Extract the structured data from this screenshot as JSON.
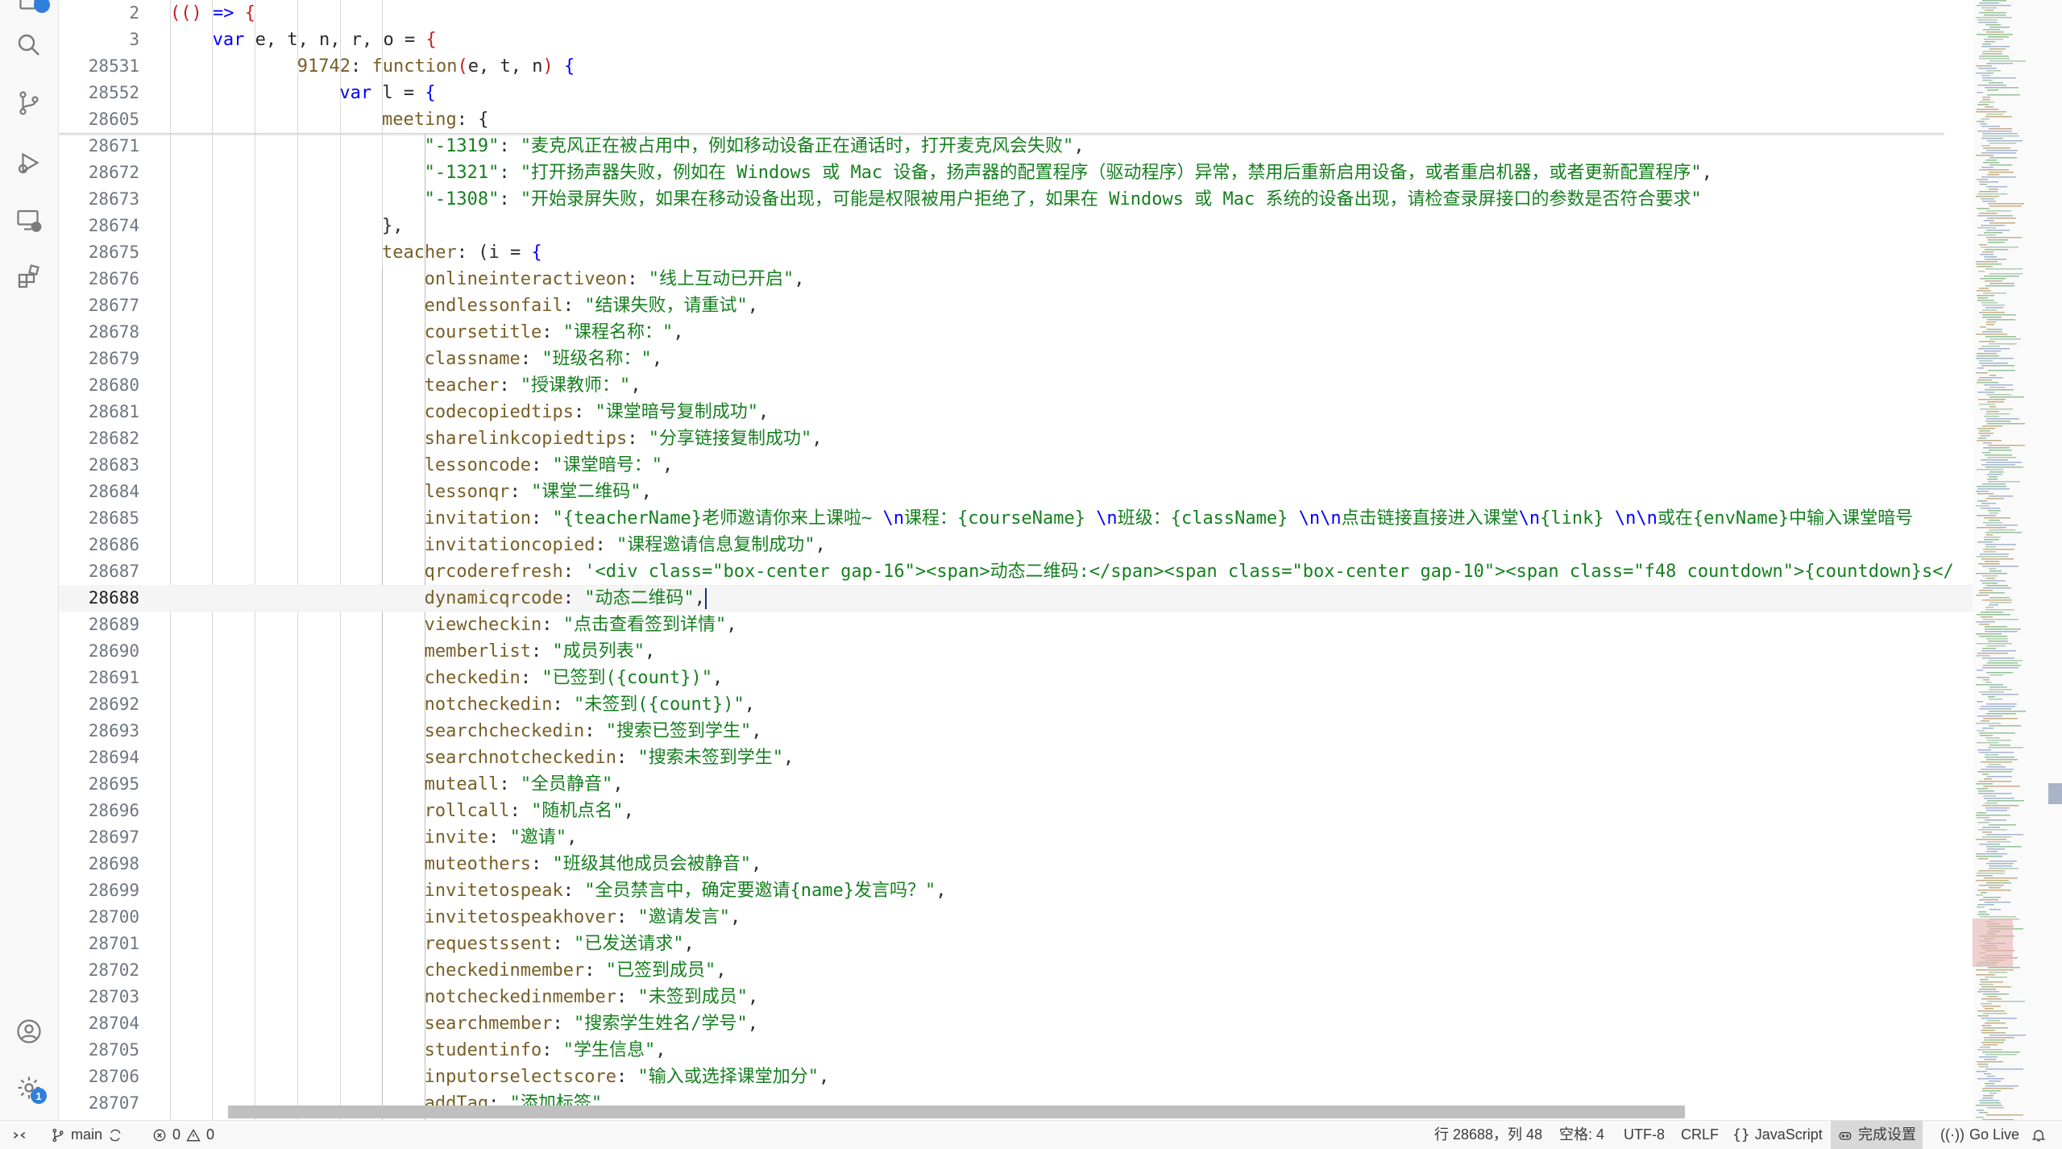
{
  "activity_bar": {
    "icons": [
      "explorer-icon",
      "search-icon",
      "source-control-icon",
      "run-debug-icon",
      "remote-explorer-icon",
      "extensions-icon",
      "account-icon",
      "settings-gear-icon"
    ],
    "settings_badge": "1"
  },
  "editor": {
    "lines": [
      {
        "n": "2",
        "indent": 0,
        "tokens": [
          [
            "p",
            "(("
          ],
          [
            "p",
            ")"
          ],
          [
            "t",
            " "
          ],
          [
            "k",
            "=>"
          ],
          [
            "t",
            " "
          ],
          [
            "p",
            "{"
          ]
        ]
      },
      {
        "n": "3",
        "indent": 1,
        "tokens": [
          [
            "k",
            "var"
          ],
          [
            "t",
            " e, t, n, r, o "
          ],
          [
            "t",
            "= "
          ],
          [
            "p",
            "{"
          ]
        ]
      },
      {
        "n": "28531",
        "indent": 3,
        "tokens": [
          [
            "n",
            "91742"
          ],
          [
            "t",
            ": "
          ],
          [
            "n",
            "function"
          ],
          [
            "p",
            "("
          ],
          [
            "t",
            "e, t, n"
          ],
          [
            "p",
            ")"
          ],
          [
            "t",
            " "
          ],
          [
            "k",
            "{"
          ]
        ]
      },
      {
        "n": "28552",
        "indent": 4,
        "tokens": [
          [
            "k",
            "var"
          ],
          [
            "t",
            " l = "
          ],
          [
            "k",
            "{"
          ]
        ]
      },
      {
        "n": "28605",
        "indent": 5,
        "tokens": [
          [
            "n",
            "meeting"
          ],
          [
            "t",
            ": {"
          ]
        ]
      },
      {
        "n": "28671",
        "indent": 6,
        "tokens": [
          [
            "s",
            "\"-1319\""
          ],
          [
            "t",
            ": "
          ],
          [
            "s",
            "\"麦克风正在被占用中，例如移动设备正在通话时，打开麦克风会失败\""
          ],
          [
            "t",
            ","
          ]
        ]
      },
      {
        "n": "28672",
        "indent": 6,
        "tokens": [
          [
            "s",
            "\"-1321\""
          ],
          [
            "t",
            ": "
          ],
          [
            "s",
            "\"打开扬声器失败，例如在 Windows 或 Mac 设备，扬声器的配置程序（驱动程序）异常，禁用后重新启用设备，或者重启机器，或者更新配置程序\""
          ],
          [
            "t",
            ","
          ]
        ]
      },
      {
        "n": "28673",
        "indent": 6,
        "tokens": [
          [
            "s",
            "\"-1308\""
          ],
          [
            "t",
            ": "
          ],
          [
            "s",
            "\"开始录屏失败，如果在移动设备出现，可能是权限被用户拒绝了，如果在 Windows 或 Mac 系统的设备出现，请检查录屏接口的参数是否符合要求\""
          ]
        ]
      },
      {
        "n": "28674",
        "indent": 5,
        "tokens": [
          [
            "t",
            "},"
          ]
        ]
      },
      {
        "n": "28675",
        "indent": 5,
        "tokens": [
          [
            "n",
            "teacher"
          ],
          [
            "t",
            ": (i = "
          ],
          [
            "k",
            "{"
          ]
        ]
      },
      {
        "n": "28676",
        "indent": 6,
        "tokens": [
          [
            "n",
            "onlineinteractiveon"
          ],
          [
            "t",
            ": "
          ],
          [
            "s",
            "\"线上互动已开启\""
          ],
          [
            "t",
            ","
          ]
        ]
      },
      {
        "n": "28677",
        "indent": 6,
        "tokens": [
          [
            "n",
            "endlessonfail"
          ],
          [
            "t",
            ": "
          ],
          [
            "s",
            "\"结课失败，请重试\""
          ],
          [
            "t",
            ","
          ]
        ]
      },
      {
        "n": "28678",
        "indent": 6,
        "tokens": [
          [
            "n",
            "coursetitle"
          ],
          [
            "t",
            ": "
          ],
          [
            "s",
            "\"课程名称：\""
          ],
          [
            "t",
            ","
          ]
        ]
      },
      {
        "n": "28679",
        "indent": 6,
        "tokens": [
          [
            "n",
            "classname"
          ],
          [
            "t",
            ": "
          ],
          [
            "s",
            "\"班级名称：\""
          ],
          [
            "t",
            ","
          ]
        ]
      },
      {
        "n": "28680",
        "indent": 6,
        "tokens": [
          [
            "n",
            "teacher"
          ],
          [
            "t",
            ": "
          ],
          [
            "s",
            "\"授课教师：\""
          ],
          [
            "t",
            ","
          ]
        ]
      },
      {
        "n": "28681",
        "indent": 6,
        "tokens": [
          [
            "n",
            "codecopiedtips"
          ],
          [
            "t",
            ": "
          ],
          [
            "s",
            "\"课堂暗号复制成功\""
          ],
          [
            "t",
            ","
          ]
        ]
      },
      {
        "n": "28682",
        "indent": 6,
        "tokens": [
          [
            "n",
            "sharelinkcopiedtips"
          ],
          [
            "t",
            ": "
          ],
          [
            "s",
            "\"分享链接复制成功\""
          ],
          [
            "t",
            ","
          ]
        ]
      },
      {
        "n": "28683",
        "indent": 6,
        "tokens": [
          [
            "n",
            "lessoncode"
          ],
          [
            "t",
            ": "
          ],
          [
            "s",
            "\"课堂暗号：\""
          ],
          [
            "t",
            ","
          ]
        ]
      },
      {
        "n": "28684",
        "indent": 6,
        "tokens": [
          [
            "n",
            "lessonqr"
          ],
          [
            "t",
            ": "
          ],
          [
            "s",
            "\"课堂二维码\""
          ],
          [
            "t",
            ","
          ]
        ]
      },
      {
        "n": "28685",
        "indent": 6,
        "tokens": [
          [
            "n",
            "invitation"
          ],
          [
            "t",
            ": "
          ],
          [
            "s",
            "\"{teacherName}老师邀请你来上课啦~ "
          ],
          [
            "k",
            "\\n"
          ],
          [
            "s",
            "课程："
          ],
          [
            "s",
            "{courseName} "
          ],
          [
            "k",
            "\\n"
          ],
          [
            "s",
            "班级："
          ],
          [
            "s",
            "{className} "
          ],
          [
            "k",
            "\\n\\n"
          ],
          [
            "s",
            "点击链接直接进入课堂"
          ],
          [
            "k",
            "\\n"
          ],
          [
            "s",
            "{link} "
          ],
          [
            "k",
            "\\n\\n"
          ],
          [
            "s",
            "或在{envName}中输入课堂暗号"
          ]
        ]
      },
      {
        "n": "28686",
        "indent": 6,
        "tokens": [
          [
            "n",
            "invitationcopied"
          ],
          [
            "t",
            ": "
          ],
          [
            "s",
            "\"课程邀请信息复制成功\""
          ],
          [
            "t",
            ","
          ]
        ]
      },
      {
        "n": "28687",
        "indent": 6,
        "tokens": [
          [
            "n",
            "qrcoderefresh"
          ],
          [
            "t",
            ": "
          ],
          [
            "s",
            "'<div class=\"box-center gap-16\"><span>动态二维码:</span><span class=\"box-center gap-10\"><span class=\"f48 countdown\">{countdown}s</"
          ]
        ]
      },
      {
        "n": "28688",
        "indent": 6,
        "current": true,
        "tokens": [
          [
            "n",
            "dynamicqrcode"
          ],
          [
            "t",
            ": "
          ],
          [
            "s",
            "\"动态二维码\""
          ],
          [
            "t",
            ","
          ]
        ]
      },
      {
        "n": "28689",
        "indent": 6,
        "tokens": [
          [
            "n",
            "viewcheckin"
          ],
          [
            "t",
            ": "
          ],
          [
            "s",
            "\"点击查看签到详情\""
          ],
          [
            "t",
            ","
          ]
        ]
      },
      {
        "n": "28690",
        "indent": 6,
        "tokens": [
          [
            "n",
            "memberlist"
          ],
          [
            "t",
            ": "
          ],
          [
            "s",
            "\"成员列表\""
          ],
          [
            "t",
            ","
          ]
        ]
      },
      {
        "n": "28691",
        "indent": 6,
        "tokens": [
          [
            "n",
            "checkedin"
          ],
          [
            "t",
            ": "
          ],
          [
            "s",
            "\"已签到({count})\""
          ],
          [
            "t",
            ","
          ]
        ]
      },
      {
        "n": "28692",
        "indent": 6,
        "tokens": [
          [
            "n",
            "notcheckedin"
          ],
          [
            "t",
            ": "
          ],
          [
            "s",
            "\"未签到({count})\""
          ],
          [
            "t",
            ","
          ]
        ]
      },
      {
        "n": "28693",
        "indent": 6,
        "tokens": [
          [
            "n",
            "searchcheckedin"
          ],
          [
            "t",
            ": "
          ],
          [
            "s",
            "\"搜索已签到学生\""
          ],
          [
            "t",
            ","
          ]
        ]
      },
      {
        "n": "28694",
        "indent": 6,
        "tokens": [
          [
            "n",
            "searchnotcheckedin"
          ],
          [
            "t",
            ": "
          ],
          [
            "s",
            "\"搜索未签到学生\""
          ],
          [
            "t",
            ","
          ]
        ]
      },
      {
        "n": "28695",
        "indent": 6,
        "tokens": [
          [
            "n",
            "muteall"
          ],
          [
            "t",
            ": "
          ],
          [
            "s",
            "\"全员静音\""
          ],
          [
            "t",
            ","
          ]
        ]
      },
      {
        "n": "28696",
        "indent": 6,
        "tokens": [
          [
            "n",
            "rollcall"
          ],
          [
            "t",
            ": "
          ],
          [
            "s",
            "\"随机点名\""
          ],
          [
            "t",
            ","
          ]
        ]
      },
      {
        "n": "28697",
        "indent": 6,
        "tokens": [
          [
            "n",
            "invite"
          ],
          [
            "t",
            ": "
          ],
          [
            "s",
            "\"邀请\""
          ],
          [
            "t",
            ","
          ]
        ]
      },
      {
        "n": "28698",
        "indent": 6,
        "tokens": [
          [
            "n",
            "muteothers"
          ],
          [
            "t",
            ": "
          ],
          [
            "s",
            "\"班级其他成员会被静音\""
          ],
          [
            "t",
            ","
          ]
        ]
      },
      {
        "n": "28699",
        "indent": 6,
        "tokens": [
          [
            "n",
            "invitetospeak"
          ],
          [
            "t",
            ": "
          ],
          [
            "s",
            "\"全员禁言中，确定要邀请{name}发言吗？\""
          ],
          [
            "t",
            ","
          ]
        ]
      },
      {
        "n": "28700",
        "indent": 6,
        "tokens": [
          [
            "n",
            "invitetospeakhover"
          ],
          [
            "t",
            ": "
          ],
          [
            "s",
            "\"邀请发言\""
          ],
          [
            "t",
            ","
          ]
        ]
      },
      {
        "n": "28701",
        "indent": 6,
        "tokens": [
          [
            "n",
            "requestssent"
          ],
          [
            "t",
            ": "
          ],
          [
            "s",
            "\"已发送请求\""
          ],
          [
            "t",
            ","
          ]
        ]
      },
      {
        "n": "28702",
        "indent": 6,
        "tokens": [
          [
            "n",
            "checkedinmember"
          ],
          [
            "t",
            ": "
          ],
          [
            "s",
            "\"已签到成员\""
          ],
          [
            "t",
            ","
          ]
        ]
      },
      {
        "n": "28703",
        "indent": 6,
        "tokens": [
          [
            "n",
            "notcheckedinmember"
          ],
          [
            "t",
            ": "
          ],
          [
            "s",
            "\"未签到成员\""
          ],
          [
            "t",
            ","
          ]
        ]
      },
      {
        "n": "28704",
        "indent": 6,
        "tokens": [
          [
            "n",
            "searchmember"
          ],
          [
            "t",
            ": "
          ],
          [
            "s",
            "\"搜索学生姓名/学号\""
          ],
          [
            "t",
            ","
          ]
        ]
      },
      {
        "n": "28705",
        "indent": 6,
        "tokens": [
          [
            "n",
            "studentinfo"
          ],
          [
            "t",
            ": "
          ],
          [
            "s",
            "\"学生信息\""
          ],
          [
            "t",
            ","
          ]
        ]
      },
      {
        "n": "28706",
        "indent": 6,
        "tokens": [
          [
            "n",
            "inputorselectscore"
          ],
          [
            "t",
            ": "
          ],
          [
            "s",
            "\"输入或选择课堂加分\""
          ],
          [
            "t",
            ","
          ]
        ]
      },
      {
        "n": "28707",
        "indent": 6,
        "tokens": [
          [
            "n",
            "addTag"
          ],
          [
            "t",
            ": "
          ],
          [
            "s",
            "\"添加标签\""
          ],
          [
            "t",
            ","
          ]
        ]
      }
    ]
  },
  "colors": {
    "keyword": "#0000ff",
    "string": "#16801f",
    "property": "#795e26",
    "bracket": "#c31d1d",
    "accent": "#2f7fdc"
  },
  "statusbar": {
    "remote_icon": "remote-icon",
    "branch": "main",
    "errors": "0",
    "warnings": "0",
    "cursor_position": "行 28688，列 48",
    "indent": "空格: 4",
    "encoding": "UTF-8",
    "eol": "CRLF",
    "language": "JavaScript",
    "setup": "完成设置",
    "go_live": "Go Live"
  }
}
